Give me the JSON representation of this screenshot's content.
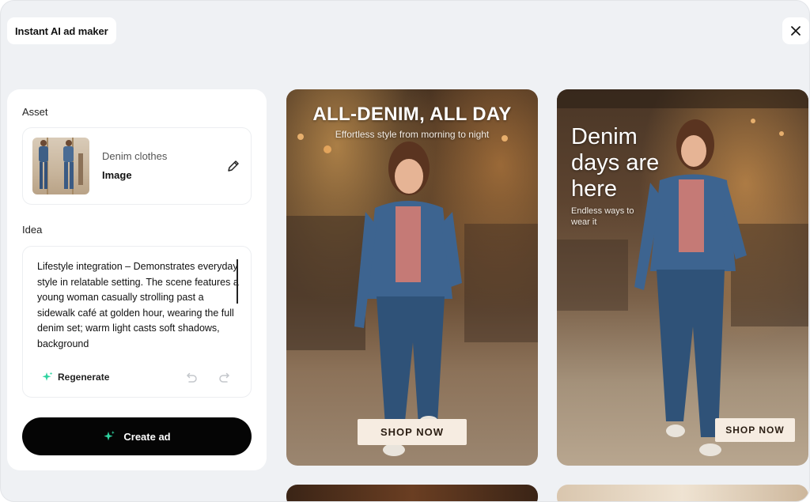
{
  "window": {
    "title": "Instant AI ad maker",
    "close_icon": "close-icon"
  },
  "panel": {
    "asset_label": "Asset",
    "asset": {
      "name": "Denim clothes",
      "type": "Image"
    },
    "idea_label": "Idea",
    "idea_text": "Lifestyle integration – Demonstrates everyday style in relatable setting. The scene features a young woman casually strolling past a sidewalk café at golden hour, wearing the full denim set; warm light casts soft shadows, background",
    "regenerate_label": "Regenerate",
    "create_label": "Create ad"
  },
  "ads": [
    {
      "headline": "ALL-DENIM, ALL DAY",
      "subheadline": "Effortless style from morning to night",
      "cta": "SHOP NOW"
    },
    {
      "headline": "Denim days are here",
      "subheadline": "Endless ways to wear it",
      "cta": "SHOP NOW"
    }
  ],
  "colors": {
    "background": "#eff1f4",
    "primary_button": "#050505",
    "cta_background": "#f6ece1",
    "sparkle": "#2fd3a0"
  }
}
